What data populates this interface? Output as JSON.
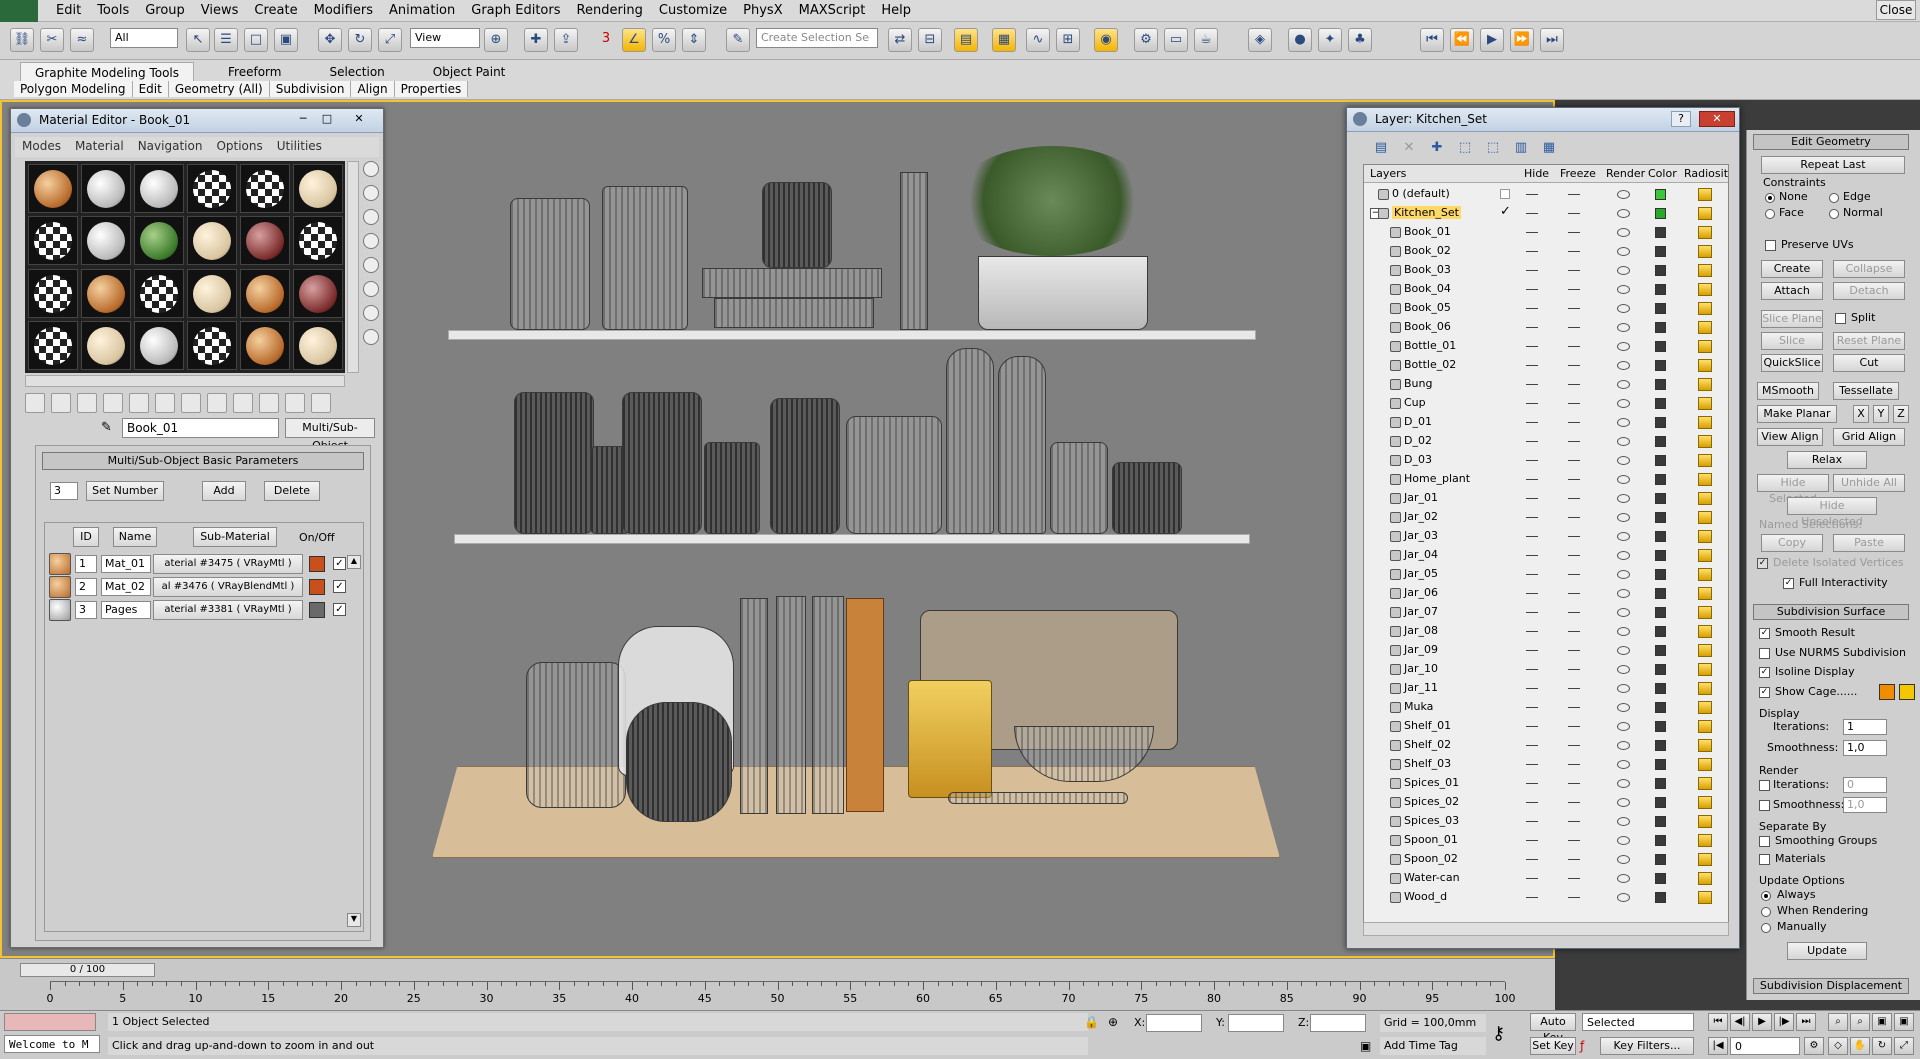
{
  "menubar": {
    "items": [
      "Edit",
      "Tools",
      "Group",
      "Views",
      "Create",
      "Modifiers",
      "Animation",
      "Graph Editors",
      "Rendering",
      "Customize",
      "PhysX",
      "MAXScript",
      "Help"
    ],
    "close_label": "Close"
  },
  "toolbar": {
    "selection_filter": "All",
    "reference_coord": "View",
    "selection_set_placeholder": "Create Selection Se",
    "snap_number": "3"
  },
  "ribbon": {
    "tabs": [
      "Graphite Modeling Tools",
      "Freeform",
      "Selection",
      "Object Paint"
    ],
    "subtabs": [
      "Polygon Modeling",
      "Edit",
      "Geometry (All)",
      "Subdivision",
      "Align",
      "Properties"
    ]
  },
  "material_editor": {
    "title": "Material Editor - Book_01",
    "menu": [
      "Modes",
      "Material",
      "Navigation",
      "Options",
      "Utilities"
    ],
    "material_name": "Book_01",
    "material_type": "Multi/Sub-Object",
    "rollout_title": "Multi/Sub-Object Basic Parameters",
    "count": "3",
    "set_number_label": "Set Number",
    "add_label": "Add",
    "delete_label": "Delete",
    "col_id": "ID",
    "col_name": "Name",
    "col_submat": "Sub-Material",
    "col_onoff": "On/Off",
    "rows": [
      {
        "id": "1",
        "name": "Mat_01",
        "submat": "aterial #3475  ( VRayMtl )",
        "color": "#c8501a"
      },
      {
        "id": "2",
        "name": "Mat_02",
        "submat": "al #3476  ( VRayBlendMtl )",
        "color": "#c8501a"
      },
      {
        "id": "3",
        "name": "Pages",
        "submat": "aterial #3381  ( VRayMtl )",
        "color": "#6a6a6a"
      }
    ]
  },
  "layer_manager": {
    "title": "Layer: Kitchen_Set",
    "columns": [
      "Layers",
      "Hide",
      "Freeze",
      "Render",
      "Color",
      "Radiosit"
    ],
    "rows": [
      {
        "name": "0 (default)",
        "level": 1,
        "color": "#3ac83a"
      },
      {
        "name": "Kitchen_Set",
        "level": 1,
        "color": "#2aa82a",
        "selected": true
      },
      {
        "name": "Book_01",
        "level": 2
      },
      {
        "name": "Book_02",
        "level": 2
      },
      {
        "name": "Book_03",
        "level": 2
      },
      {
        "name": "Book_04",
        "level": 2
      },
      {
        "name": "Book_05",
        "level": 2
      },
      {
        "name": "Book_06",
        "level": 2
      },
      {
        "name": "Bottle_01",
        "level": 2
      },
      {
        "name": "Bottle_02",
        "level": 2
      },
      {
        "name": "Bung",
        "level": 2
      },
      {
        "name": "Cup",
        "level": 2
      },
      {
        "name": "D_01",
        "level": 2
      },
      {
        "name": "D_02",
        "level": 2
      },
      {
        "name": "D_03",
        "level": 2
      },
      {
        "name": "Home_plant",
        "level": 2
      },
      {
        "name": "Jar_01",
        "level": 2
      },
      {
        "name": "Jar_02",
        "level": 2
      },
      {
        "name": "Jar_03",
        "level": 2
      },
      {
        "name": "Jar_04",
        "level": 2
      },
      {
        "name": "Jar_05",
        "level": 2
      },
      {
        "name": "Jar_06",
        "level": 2
      },
      {
        "name": "Jar_07",
        "level": 2
      },
      {
        "name": "Jar_08",
        "level": 2
      },
      {
        "name": "Jar_09",
        "level": 2
      },
      {
        "name": "Jar_10",
        "level": 2
      },
      {
        "name": "Jar_11",
        "level": 2
      },
      {
        "name": "Muka",
        "level": 2
      },
      {
        "name": "Shelf_01",
        "level": 2
      },
      {
        "name": "Shelf_02",
        "level": 2
      },
      {
        "name": "Shelf_03",
        "level": 2
      },
      {
        "name": "Spices_01",
        "level": 2
      },
      {
        "name": "Spices_02",
        "level": 2
      },
      {
        "name": "Spices_03",
        "level": 2
      },
      {
        "name": "Spoon_01",
        "level": 2
      },
      {
        "name": "Spoon_02",
        "level": 2
      },
      {
        "name": "Water-can",
        "level": 2
      },
      {
        "name": "Wood_d",
        "level": 2
      }
    ]
  },
  "command_panel": {
    "edit_geometry": "Edit Geometry",
    "repeat_last": "Repeat Last",
    "constraints": "Constraints",
    "c_none": "None",
    "c_edge": "Edge",
    "c_face": "Face",
    "c_normal": "Normal",
    "preserve_uvs": "Preserve UVs",
    "create": "Create",
    "collapse": "Collapse",
    "attach": "Attach",
    "detach": "Detach",
    "slice_plane": "Slice Plane",
    "split": "Split",
    "slice": "Slice",
    "reset_plane": "Reset Plane",
    "quickslice": "QuickSlice",
    "cut": "Cut",
    "msmooth": "MSmooth",
    "tessellate": "Tessellate",
    "make_planar": "Make Planar",
    "x": "X",
    "y": "Y",
    "z": "Z",
    "view_align": "View Align",
    "grid_align": "Grid Align",
    "relax": "Relax",
    "hide_selected": "Hide Selected",
    "unhide_all": "Unhide All",
    "hide_unselected": "Hide Unselected",
    "named_selections": "Named Selections:",
    "copy": "Copy",
    "paste": "Paste",
    "delete_isolated": "Delete Isolated Vertices",
    "full_interactivity": "Full Interactivity",
    "subdivision_surface": "Subdivision Surface",
    "smooth_result": "Smooth Result",
    "use_nurms": "Use NURMS Subdivision",
    "isoline_display": "Isoline Display",
    "show_cage": "Show Cage......",
    "display": "Display",
    "iterations": "Iterations:",
    "iterations_val": "1",
    "smoothness": "Smoothness:",
    "smoothness_val": "1,0",
    "render": "Render",
    "r_iterations": "Iterations:",
    "r_iterations_val": "0",
    "r_smoothness": "Smoothness:",
    "r_smoothness_val": "1,0",
    "separate_by": "Separate By",
    "smoothing_groups": "Smoothing Groups",
    "materials": "Materials",
    "update_options": "Update Options",
    "always": "Always",
    "when_rendering": "When Rendering",
    "manually": "Manually",
    "update": "Update",
    "subdivision_displacement": "Subdivision Displacement",
    "cage_color1": "#f08c00",
    "cage_color2": "#f4c800"
  },
  "timeline": {
    "slider": "0 / 100",
    "ticks": [
      "0",
      "5",
      "10",
      "15",
      "20",
      "25",
      "30",
      "35",
      "40",
      "45",
      "50",
      "55",
      "60",
      "65",
      "70",
      "75",
      "80",
      "85",
      "90",
      "95",
      "100"
    ]
  },
  "status": {
    "listener": "Welcome to M",
    "selection": "1 Object Selected",
    "prompt": "Click and drag up-and-down to zoom in and out",
    "x_label": "X:",
    "y_label": "Y:",
    "z_label": "Z:",
    "grid": "Grid = 100,0mm",
    "add_time_tag": "Add Time Tag",
    "auto_key": "Auto Key",
    "set_key": "Set Key",
    "key_mode": "Selected",
    "key_filters": "Key Filters...",
    "frame": "0"
  }
}
